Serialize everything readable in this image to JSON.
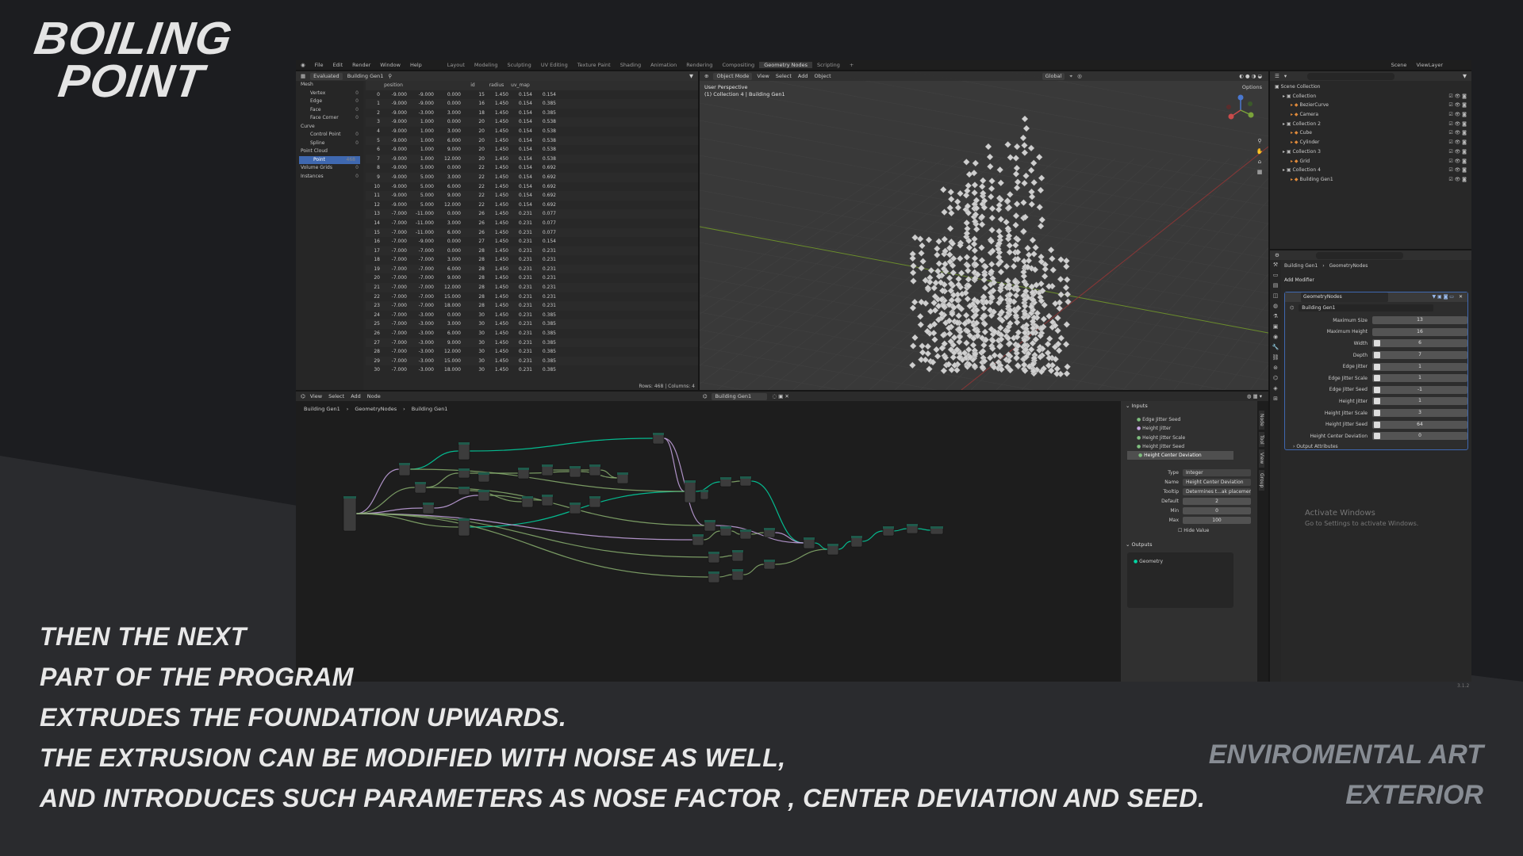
{
  "brand": {
    "line1": "BOILING",
    "line2": "POINT"
  },
  "caption": {
    "line1": "THEN THE NEXT",
    "line2": "PART OF THE PROGRAM",
    "line3": "EXTRUDES THE FOUNDATION UPWARDS.",
    "line4": "THE EXTRUSION CAN BE MODIFIED WITH NOISE AS WELL,",
    "line5": "AND INTRODUCES SUCH PARAMETERS AS NOSE FACTOR , CENTER DEVIATION AND SEED."
  },
  "side_label": {
    "line1": "ENVIROMENTAL ART",
    "line2": "EXTERIOR"
  },
  "watermark": {
    "title": "Activate Windows",
    "subtitle": "Go to Settings to activate Windows."
  },
  "version": "3.1.2",
  "menu": [
    "File",
    "Edit",
    "Render",
    "Window",
    "Help"
  ],
  "workspaces": [
    {
      "label": "Layout",
      "active": false
    },
    {
      "label": "Modeling",
      "active": false
    },
    {
      "label": "Sculpting",
      "active": false
    },
    {
      "label": "UV Editing",
      "active": false
    },
    {
      "label": "Texture Paint",
      "active": false
    },
    {
      "label": "Shading",
      "active": false
    },
    {
      "label": "Animation",
      "active": false
    },
    {
      "label": "Rendering",
      "active": false
    },
    {
      "label": "Compositing",
      "active": false
    },
    {
      "label": "Geometry Nodes",
      "active": true
    },
    {
      "label": "Scripting",
      "active": false
    },
    {
      "label": "+",
      "active": false
    }
  ],
  "topbar_right": {
    "scene": "Scene",
    "view_layer": "ViewLayer"
  },
  "spreadsheet": {
    "mode": "Evaluated",
    "object": "Building Gen1",
    "sidebar": [
      {
        "label": "Mesh",
        "sub": false,
        "count": "",
        "selected": false
      },
      {
        "label": "Vertex",
        "sub": true,
        "count": "0",
        "selected": false
      },
      {
        "label": "Edge",
        "sub": true,
        "count": "0",
        "selected": false
      },
      {
        "label": "Face",
        "sub": true,
        "count": "0",
        "selected": false
      },
      {
        "label": "Face Corner",
        "sub": true,
        "count": "0",
        "selected": false
      },
      {
        "label": "Curve",
        "sub": false,
        "count": "",
        "selected": false
      },
      {
        "label": "Control Point",
        "sub": true,
        "count": "0",
        "selected": false
      },
      {
        "label": "Spline",
        "sub": true,
        "count": "0",
        "selected": false
      },
      {
        "label": "Point Cloud",
        "sub": false,
        "count": "",
        "selected": false
      },
      {
        "label": "Point",
        "sub": true,
        "count": "468",
        "selected": true
      },
      {
        "label": "Volume Grids",
        "sub": false,
        "count": "0",
        "selected": false
      },
      {
        "label": "Instances",
        "sub": false,
        "count": "0",
        "selected": false
      }
    ],
    "columns": [
      "",
      "position",
      "",
      "",
      "id",
      "radius",
      "uv_map",
      ""
    ],
    "rows": [
      [
        "0",
        "-9.000",
        "-9.000",
        "0.000",
        "15",
        "1.450",
        "0.154",
        "0.154"
      ],
      [
        "1",
        "-9.000",
        "-9.000",
        "0.000",
        "16",
        "1.450",
        "0.154",
        "0.385"
      ],
      [
        "2",
        "-9.000",
        "-3.000",
        "3.000",
        "18",
        "1.450",
        "0.154",
        "0.385"
      ],
      [
        "3",
        "-9.000",
        "1.000",
        "0.000",
        "20",
        "1.450",
        "0.154",
        "0.538"
      ],
      [
        "4",
        "-9.000",
        "1.000",
        "3.000",
        "20",
        "1.450",
        "0.154",
        "0.538"
      ],
      [
        "5",
        "-9.000",
        "1.000",
        "6.000",
        "20",
        "1.450",
        "0.154",
        "0.538"
      ],
      [
        "6",
        "-9.000",
        "1.000",
        "9.000",
        "20",
        "1.450",
        "0.154",
        "0.538"
      ],
      [
        "7",
        "-9.000",
        "1.000",
        "12.000",
        "20",
        "1.450",
        "0.154",
        "0.538"
      ],
      [
        "8",
        "-9.000",
        "5.000",
        "0.000",
        "22",
        "1.450",
        "0.154",
        "0.692"
      ],
      [
        "9",
        "-9.000",
        "5.000",
        "3.000",
        "22",
        "1.450",
        "0.154",
        "0.692"
      ],
      [
        "10",
        "-9.000",
        "5.000",
        "6.000",
        "22",
        "1.450",
        "0.154",
        "0.692"
      ],
      [
        "11",
        "-9.000",
        "5.000",
        "9.000",
        "22",
        "1.450",
        "0.154",
        "0.692"
      ],
      [
        "12",
        "-9.000",
        "5.000",
        "12.000",
        "22",
        "1.450",
        "0.154",
        "0.692"
      ],
      [
        "13",
        "-7.000",
        "-11.000",
        "0.000",
        "26",
        "1.450",
        "0.231",
        "0.077"
      ],
      [
        "14",
        "-7.000",
        "-11.000",
        "3.000",
        "26",
        "1.450",
        "0.231",
        "0.077"
      ],
      [
        "15",
        "-7.000",
        "-11.000",
        "6.000",
        "26",
        "1.450",
        "0.231",
        "0.077"
      ],
      [
        "16",
        "-7.000",
        "-9.000",
        "0.000",
        "27",
        "1.450",
        "0.231",
        "0.154"
      ],
      [
        "17",
        "-7.000",
        "-7.000",
        "0.000",
        "28",
        "1.450",
        "0.231",
        "0.231"
      ],
      [
        "18",
        "-7.000",
        "-7.000",
        "3.000",
        "28",
        "1.450",
        "0.231",
        "0.231"
      ],
      [
        "19",
        "-7.000",
        "-7.000",
        "6.000",
        "28",
        "1.450",
        "0.231",
        "0.231"
      ],
      [
        "20",
        "-7.000",
        "-7.000",
        "9.000",
        "28",
        "1.450",
        "0.231",
        "0.231"
      ],
      [
        "21",
        "-7.000",
        "-7.000",
        "12.000",
        "28",
        "1.450",
        "0.231",
        "0.231"
      ],
      [
        "22",
        "-7.000",
        "-7.000",
        "15.000",
        "28",
        "1.450",
        "0.231",
        "0.231"
      ],
      [
        "23",
        "-7.000",
        "-7.000",
        "18.000",
        "28",
        "1.450",
        "0.231",
        "0.231"
      ],
      [
        "24",
        "-7.000",
        "-3.000",
        "0.000",
        "30",
        "1.450",
        "0.231",
        "0.385"
      ],
      [
        "25",
        "-7.000",
        "-3.000",
        "3.000",
        "30",
        "1.450",
        "0.231",
        "0.385"
      ],
      [
        "26",
        "-7.000",
        "-3.000",
        "6.000",
        "30",
        "1.450",
        "0.231",
        "0.385"
      ],
      [
        "27",
        "-7.000",
        "-3.000",
        "9.000",
        "30",
        "1.450",
        "0.231",
        "0.385"
      ],
      [
        "28",
        "-7.000",
        "-3.000",
        "12.000",
        "30",
        "1.450",
        "0.231",
        "0.385"
      ],
      [
        "29",
        "-7.000",
        "-3.000",
        "15.000",
        "30",
        "1.450",
        "0.231",
        "0.385"
      ],
      [
        "30",
        "-7.000",
        "-3.000",
        "18.000",
        "30",
        "1.450",
        "0.231",
        "0.385"
      ]
    ],
    "footer": "Rows: 468   |   Columns: 4"
  },
  "viewport": {
    "mode": "Object Mode",
    "menus": [
      "View",
      "Select",
      "Add",
      "Object"
    ],
    "orientation": "Global",
    "options": "Options",
    "info_line1": "User Perspective",
    "info_line2": "(1) Collection 4 | Building Gen1"
  },
  "outliner": {
    "header": "Scene Collection",
    "rows": [
      {
        "label": "Collection",
        "indent": 1
      },
      {
        "label": "BezierCurve",
        "indent": 2
      },
      {
        "label": "Camera",
        "indent": 2
      },
      {
        "label": "Collection 2",
        "indent": 1
      },
      {
        "label": "Cube",
        "indent": 2
      },
      {
        "label": "Cylinder",
        "indent": 2
      },
      {
        "label": "Collection 3",
        "indent": 1
      },
      {
        "label": "Grid",
        "indent": 2
      },
      {
        "label": "Collection 4",
        "indent": 1
      },
      {
        "label": "Building Gen1",
        "indent": 2
      }
    ]
  },
  "properties": {
    "breadcrumb_object": "Building Gen1",
    "breadcrumb_modifier": "GeometryNodes",
    "add_modifier": "Add Modifier",
    "modifier_name": "GeometryNodes",
    "node_group": "Building Gen1",
    "fields": [
      {
        "label": "Maximum Size",
        "value": "13"
      },
      {
        "label": "Maximum Height",
        "value": "16"
      },
      {
        "label": "Width",
        "value": "6"
      },
      {
        "label": "Depth",
        "value": "7"
      },
      {
        "label": "Edge Jitter",
        "value": "1"
      },
      {
        "label": "Edge Jitter Scale",
        "value": "1"
      },
      {
        "label": "Edge Jitter Seed",
        "value": "-1"
      },
      {
        "label": "Height Jitter",
        "value": "1"
      },
      {
        "label": "Height Jitter Scale",
        "value": "3"
      },
      {
        "label": "Height Jitter Seed",
        "value": "64"
      },
      {
        "label": "Height Center Deviation",
        "value": "0"
      }
    ],
    "output_attributes": "Output Attributes"
  },
  "node_editor": {
    "menus": [
      "View",
      "Select",
      "Add",
      "Node"
    ],
    "node_tree": "Building Gen1",
    "breadcrumb": [
      "Building Gen1",
      "GeometryNodes",
      "Building Gen1"
    ],
    "side_tabs": [
      "Node",
      "Tool",
      "View",
      "Group"
    ]
  },
  "group_panel": {
    "inputs_title": "Inputs",
    "inputs": [
      {
        "label": "Edge Jitter Seed",
        "selected": false
      },
      {
        "label": "Height Jitter",
        "selected": false
      },
      {
        "label": "Height Jitter Scale",
        "selected": false
      },
      {
        "label": "Height Jitter Seed",
        "selected": false
      },
      {
        "label": "Height Center Deviation",
        "selected": true
      }
    ],
    "props": [
      {
        "label": "Type",
        "value": "Integer"
      },
      {
        "label": "Name",
        "value": "Height Center Deviation"
      },
      {
        "label": "Tooltip",
        "value": "Determines t...ak placement"
      },
      {
        "label": "Default",
        "value": "2"
      },
      {
        "label": "Min",
        "value": "0"
      },
      {
        "label": "Max",
        "value": "100"
      }
    ],
    "hide_value": "Hide Value",
    "outputs_title": "Outputs",
    "outputs": [
      "Geometry"
    ]
  },
  "colors": {
    "accent_blue": "#3f68b0",
    "geometry_link": "#00d6a3",
    "shader_link": "#c8a6e4",
    "node_body": "#3c3c3c"
  }
}
